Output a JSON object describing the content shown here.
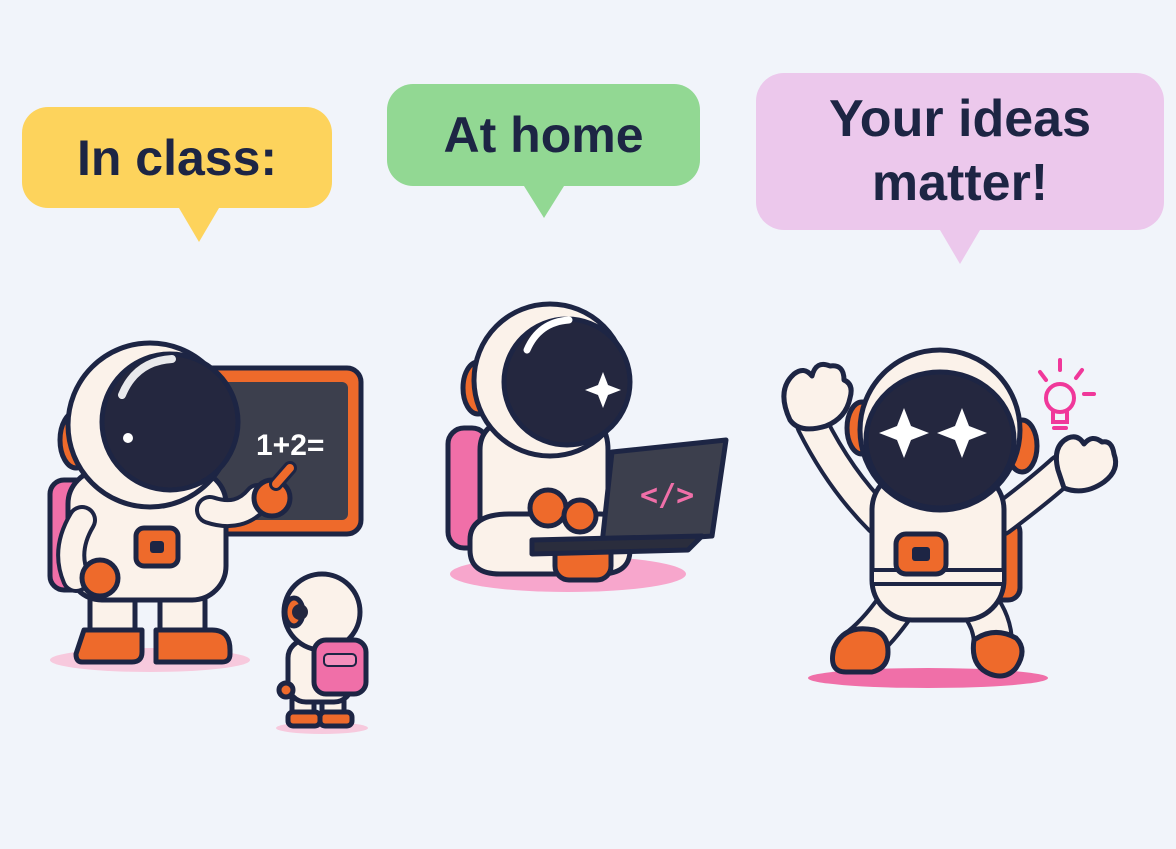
{
  "bubbles": {
    "in_class": "In class:",
    "at_home": "At home",
    "ideas_line1": "Your ideas",
    "ideas_line2": "matter!"
  },
  "chalkboard": {
    "equation": "1+2="
  },
  "laptop": {
    "code_symbol": "</>"
  },
  "colors": {
    "background": "#f1f4fa",
    "bubble_yellow": "#fdd35c",
    "bubble_green": "#92d893",
    "bubble_pink": "#ecc8ec",
    "suit": "#fbf2ea",
    "visor": "#24273f",
    "accent_orange": "#ee6a2b",
    "accent_pink": "#f06fa8"
  },
  "icons": [
    "chalkboard-icon",
    "laptop-icon",
    "lightbulb-icon",
    "sparkle-icon"
  ]
}
